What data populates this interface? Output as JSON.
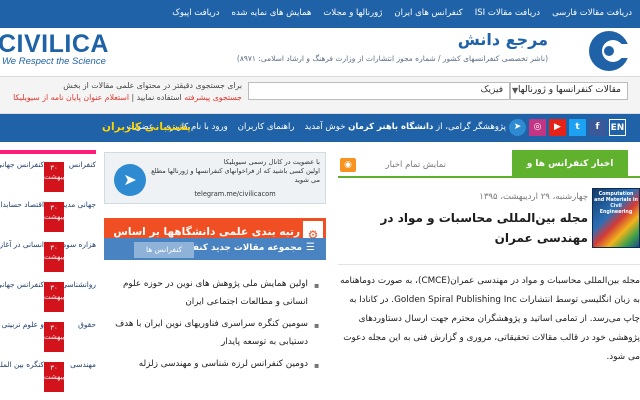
{
  "top_nav": [
    "دریافت مقالات فارسی",
    "دریافت مقالات ISI",
    "کنفرانس های ایران",
    "ژورنالها و مجلات",
    "همایش های نمایه شده",
    "دریافت اپیوک"
  ],
  "logo": {
    "text": "CIVILICA",
    "tagline": "We Respect the Science"
  },
  "brand": {
    "title": "مرجع دانش",
    "subtitle": "(ناشر تخصصی کنفرانسهای کشور / شماره مجوز انتشارات از وزارت فرهنگ و ارشاد اسلامی: ۸۹۷۱)"
  },
  "search": {
    "scope": "مقالات کنفرانسها و ژورنالها",
    "query": "فیزیک",
    "hint_line1": "برای جستجوی دقیقتر در محتوای علمی مقالات از بخش",
    "hint_line2_red_a": "جستجوی پیشرفته",
    "hint_line2_mid": " استفاده نمایید | ",
    "hint_line2_red_b": "استعلام عنوان پایان نامه از سیویلیکا"
  },
  "nav": {
    "greeting": "پژوهشگر گرامی، از",
    "university": "دانشگاه باهنر کرمان",
    "welcome": "خوش آمدید",
    "links": [
      "راهنمای کاربران",
      "ورود با نام کاربری",
      "عضویت"
    ],
    "support": "پشتیبانی کاربران",
    "social": [
      "EN",
      "f",
      "t",
      "yt",
      "ig",
      "tg"
    ]
  },
  "left_news": [
    {
      "badge": "۳۰ اردیبهشت",
      "text": "کنفرانس جهانی مدیریت",
      "text2": "کنفرانس"
    },
    {
      "badge": "۳۰ اردیبهشت",
      "text": "اقتصاد حسابداری و",
      "text2": "جهانی مدیر"
    },
    {
      "badge": "۳۰ اردیبهشت",
      "text": "انسانی در آغاز",
      "text2": "هزاره سوم"
    },
    {
      "badge": "۳۰ اردیبهشت",
      "text": "کنفرانس جهانی",
      "text2": "روانشناسی"
    },
    {
      "badge": "۳۰ اردیبهشت",
      "text": "و علوم تربیتی",
      "text2": "حقوق"
    },
    {
      "badge": "۳۰ اردیبهشت",
      "text": "کنگره بین المللی",
      "text2": "مهندسی"
    }
  ],
  "telegram": {
    "line1": "با عضویت در کانال رسمی سیویلیکا",
    "line2": "اولین کسی باشید که از فراخوانهای کنفرانسها و ژورنالها مطلع می شوید",
    "url": "telegram.me/civilicacom"
  },
  "ranking": {
    "text": "رتبه بندی علمی دانشگاهها بر اساس تولید"
  },
  "new_conf": {
    "title": "مجموعه مقالات جدید کنفرانس ها",
    "tab": "کنفرانس ها",
    "items": [
      "اولین همایش ملی پژوهش های نوین در حوزه علوم",
      "انسانی و مطالعات اجتماعی ایران",
      "سومین کنگره سراسری فناوریهای نوین ایران با هدف",
      "دستیابی به توسعه پایدار",
      "دومین کنفرانس لرزه شناسی و مهندسی زلزله"
    ]
  },
  "main": {
    "tab_news": "اخبار کنفرانس ها و ژورنالها",
    "rss_label": "نمایش تمام اخبار",
    "date": "چهارشنبه، ۲۹ اردیبهشت، ۱۳۹۵",
    "title": "مجله بین‌المللی محاسبات و مواد در مهندسی عمران",
    "thumb_caption": "Computation and Materials in Civil Engineering",
    "body": "مجله بین‌المللی محاسبات و مواد در مهندسی عمران(CMCE)، به صورت دوماهنامه به زبان انگلیسی توسط انتشارات Golden Spiral Publishing Inc. در کانادا به چاپ می‌رسد. از تمامی اساتید و پژوهشگران محترم جهت ارسال دستاوردهای پژوهشی خود در قالب مقالات تحقیقاتی، مروری و گزارش فنی به این مجله دعوت می شود."
  }
}
